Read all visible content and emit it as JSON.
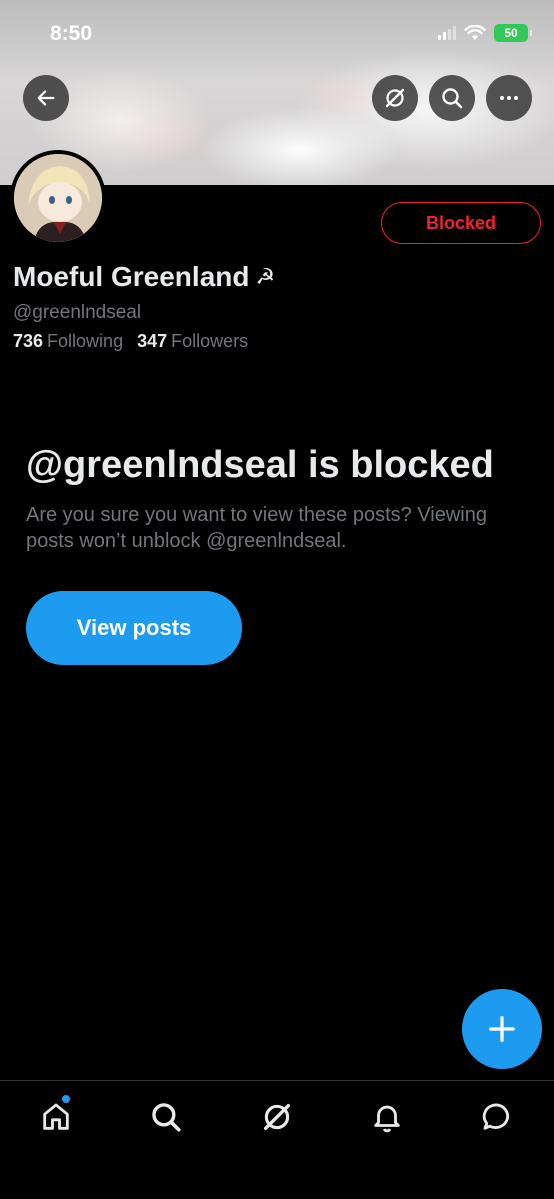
{
  "status_bar": {
    "time": "8:50",
    "battery": "50"
  },
  "header": {
    "back_icon": "arrow-left-icon",
    "grok_icon": "grok-icon",
    "search_icon": "search-icon",
    "more_icon": "more-horizontal-icon"
  },
  "profile": {
    "display_name": "Moeful Greenland",
    "name_emoji": "☭",
    "handle": "@greenlndseal",
    "following_count": "736",
    "following_label": "Following",
    "followers_count": "347",
    "followers_label": "Followers",
    "blocked_button": "Blocked"
  },
  "blocked_notice": {
    "title": "@greenlndseal is blocked",
    "description": "Are you sure you want to view these posts? Viewing posts won’t unblock @greenlndseal.",
    "view_button": "View posts"
  },
  "tab_bar": {
    "items": [
      "home-icon",
      "search-icon",
      "grok-icon",
      "notifications-icon",
      "messages-icon"
    ]
  },
  "colors": {
    "accent": "#1d9bf0",
    "blocked_red": "#f4212e",
    "secondary_text": "#71767b"
  }
}
